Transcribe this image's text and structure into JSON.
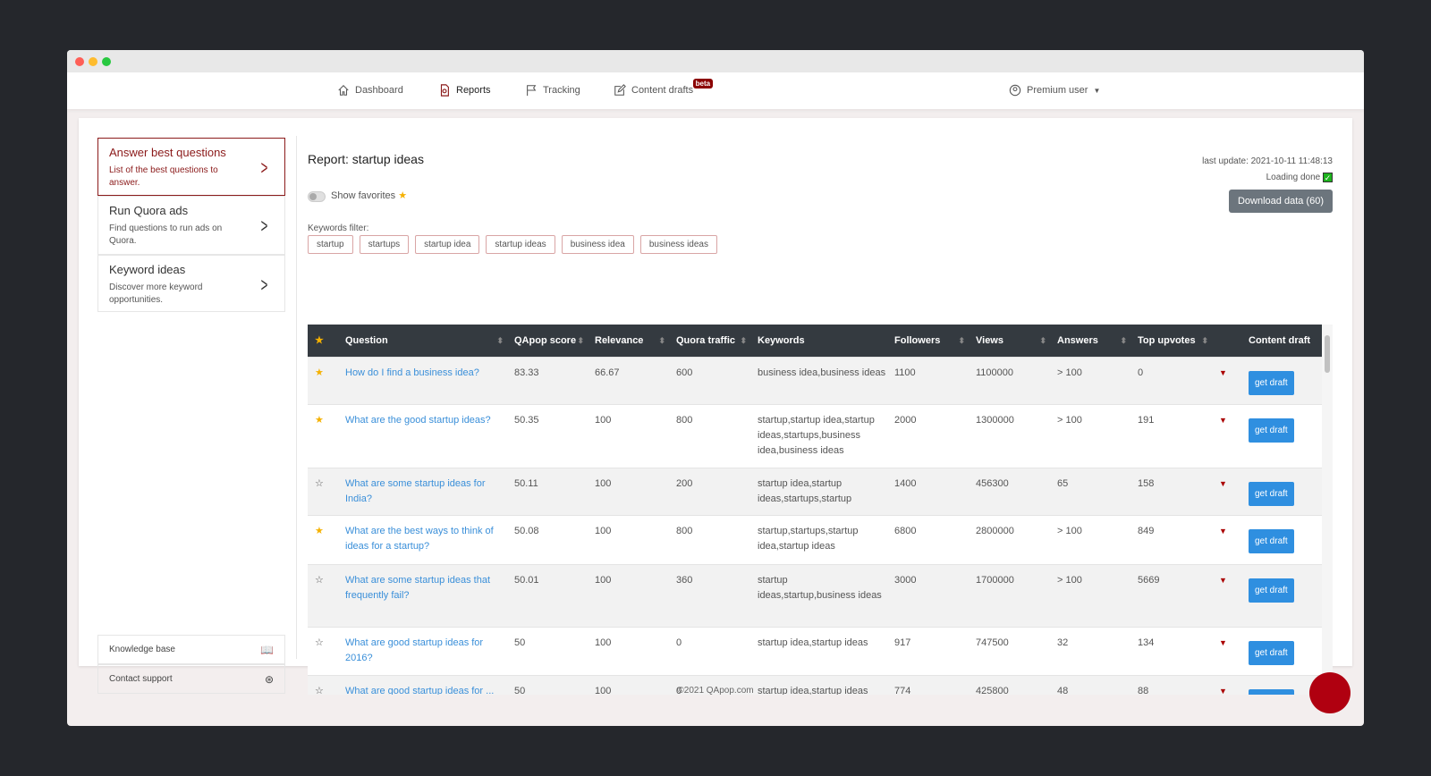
{
  "nav": {
    "items": [
      {
        "label": "Dashboard",
        "icon": "home-icon"
      },
      {
        "label": "Reports",
        "icon": "report-icon"
      },
      {
        "label": "Tracking",
        "icon": "flag-icon"
      },
      {
        "label": "Content drafts",
        "icon": "edit-icon",
        "badge": "beta"
      }
    ],
    "user": "Premium user"
  },
  "sidebar": {
    "items": [
      {
        "title": "Answer best questions",
        "desc": "List of the best questions to answer."
      },
      {
        "title": "Run Quora ads",
        "desc": "Find questions to run ads on Quora."
      },
      {
        "title": "Keyword ideas",
        "desc": "Discover more keyword opportunities."
      }
    ],
    "links": [
      {
        "label": "Knowledge base"
      },
      {
        "label": "Contact support"
      }
    ]
  },
  "report": {
    "title": "Report: startup ideas",
    "last_update": "last update: 2021-10-11 11:48:13",
    "loading": "Loading done",
    "download": "Download data (60)",
    "show_favorites": "Show favorites",
    "keywords_label": "Keywords filter:",
    "keywords": [
      "startup",
      "startups",
      "startup idea",
      "startup ideas",
      "business idea",
      "business ideas"
    ]
  },
  "table": {
    "headers": [
      "Question",
      "QApop score",
      "Relevance",
      "Quora traffic",
      "Keywords",
      "Followers",
      "Views",
      "Answers",
      "Top upvotes",
      "Content draft"
    ],
    "button": "get draft",
    "rows": [
      {
        "fav": true,
        "question": "How do I find a business idea?",
        "score": "83.33",
        "relevance": "66.67",
        "traffic": "600",
        "keywords": "business idea,business ideas",
        "followers": "1100",
        "views": "1100000",
        "answers": "> 100",
        "upvotes": "0"
      },
      {
        "fav": true,
        "question": "What are the good startup ideas?",
        "score": "50.35",
        "relevance": "100",
        "traffic": "800",
        "keywords": "startup,startup idea,startup ideas,startups,business idea,business ideas",
        "followers": "2000",
        "views": "1300000",
        "answers": "> 100",
        "upvotes": "191"
      },
      {
        "fav": false,
        "question": "What are some startup ideas for India?",
        "score": "50.11",
        "relevance": "100",
        "traffic": "200",
        "keywords": "startup idea,startup ideas,startups,startup",
        "followers": "1400",
        "views": "456300",
        "answers": "65",
        "upvotes": "158"
      },
      {
        "fav": true,
        "question": "What are the best ways to think of ideas for a startup?",
        "score": "50.08",
        "relevance": "100",
        "traffic": "800",
        "keywords": "startup,startups,startup idea,startup ideas",
        "followers": "6800",
        "views": "2800000",
        "answers": "> 100",
        "upvotes": "849"
      },
      {
        "fav": false,
        "question": "What are some startup ideas that frequently fail?",
        "score": "50.01",
        "relevance": "100",
        "traffic": "360",
        "keywords": "startup ideas,startup,business ideas",
        "followers": "3000",
        "views": "1700000",
        "answers": "> 100",
        "upvotes": "5669"
      },
      {
        "fav": false,
        "question": "What are good startup ideas for 2016?",
        "score": "50",
        "relevance": "100",
        "traffic": "0",
        "keywords": "startup idea,startup ideas",
        "followers": "917",
        "views": "747500",
        "answers": "32",
        "upvotes": "134"
      },
      {
        "fav": false,
        "question": "What are good startup ideas for ...",
        "score": "50",
        "relevance": "100",
        "traffic": "0",
        "keywords": "startup idea,startup ideas",
        "followers": "774",
        "views": "425800",
        "answers": "48",
        "upvotes": "88"
      }
    ]
  },
  "footer": "©2021 QApop.com",
  "colors": {
    "brand": "#8b1a1a",
    "link": "#3a8fd9",
    "button": "#2f8fe0",
    "header": "#343a40"
  }
}
